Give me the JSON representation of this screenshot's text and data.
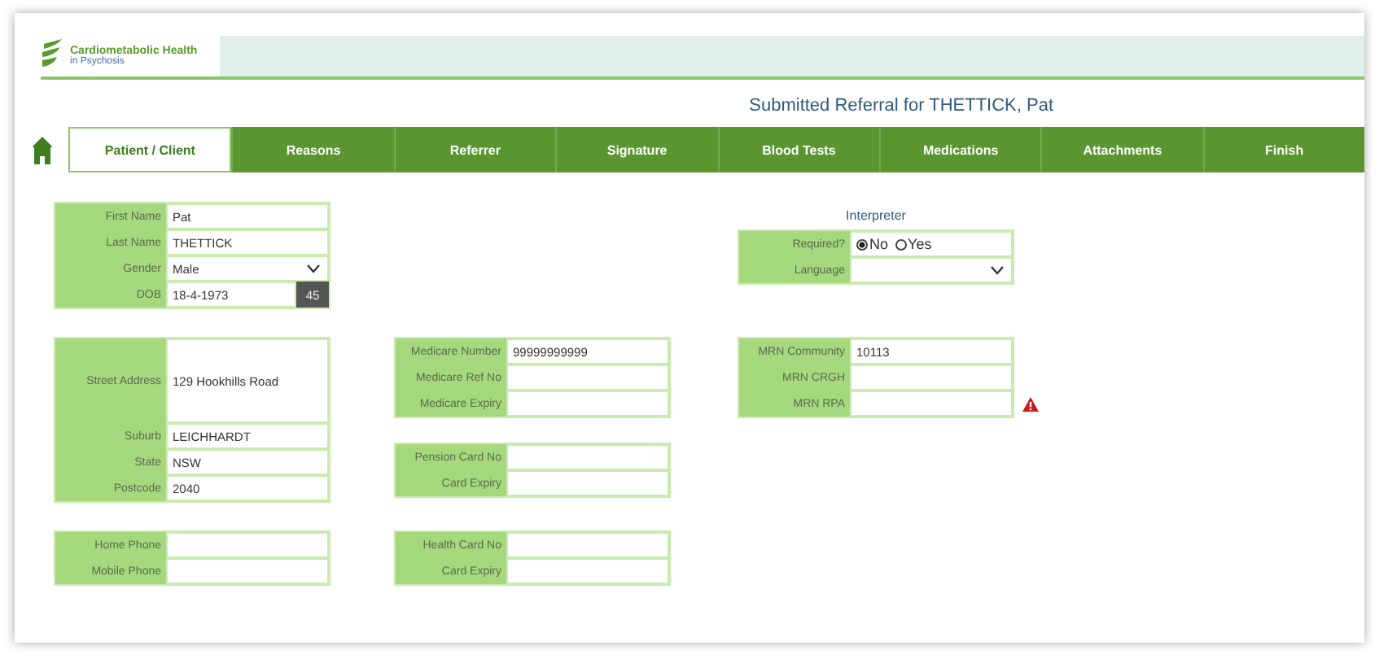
{
  "logo": {
    "lines": [
      "Cardiometabolic Health",
      "in Psychosis"
    ]
  },
  "title": "Submitted Referral for THETTICK, Pat",
  "tabs": [
    {
      "label": "Patient / Client",
      "selected": true
    },
    {
      "label": "Reasons",
      "selected": false
    },
    {
      "label": "Referrer",
      "selected": false
    },
    {
      "label": "Signature",
      "selected": false
    },
    {
      "label": "Blood Tests",
      "selected": false
    },
    {
      "label": "Medications",
      "selected": false
    },
    {
      "label": "Attachments",
      "selected": false
    },
    {
      "label": "Finish",
      "selected": false
    }
  ],
  "bands": [
    {
      "left": [
        {
          "fields": [
            {
              "kind": "text",
              "label": "First Name",
              "value": "Pat"
            },
            {
              "kind": "text",
              "label": "Last Name",
              "value": "THETTICK"
            },
            {
              "kind": "select",
              "label": "Gender",
              "value": "Male"
            },
            {
              "kind": "dob",
              "label": "DOB",
              "value": "18-4-1973",
              "age": "45"
            }
          ]
        }
      ],
      "right": [
        {
          "heading": "Interpreter",
          "fields": [
            {
              "kind": "radio",
              "label": "Required?",
              "options": [
                {
                  "label": "No",
                  "selected": true
                },
                {
                  "label": "Yes",
                  "selected": false
                }
              ]
            },
            {
              "kind": "select",
              "label": "Language"
            }
          ]
        }
      ]
    },
    {
      "left": [
        {
          "fields": [
            {
              "kind": "multiline",
              "label": "Street Address",
              "value": "129 Hookhills Road"
            },
            {
              "kind": "text",
              "label": "Suburb",
              "value": "LEICHHARDT"
            },
            {
              "kind": "text",
              "label": "State",
              "value": "NSW"
            },
            {
              "kind": "text",
              "label": "Postcode",
              "value": "2040"
            }
          ]
        }
      ],
      "middle": [
        {
          "fields": [
            {
              "kind": "text",
              "label": "Medicare Number",
              "value": "99999999999"
            },
            {
              "kind": "text",
              "label": "Medicare Ref No"
            },
            {
              "kind": "text",
              "label": "Medicare Expiry"
            }
          ]
        },
        {
          "fields": [
            {
              "kind": "text",
              "label": "Pension Card No"
            },
            {
              "kind": "text",
              "label": "Card Expiry"
            }
          ]
        }
      ],
      "right": [
        {
          "fields": [
            {
              "kind": "text",
              "label": "MRN Community",
              "value": "10113"
            },
            {
              "kind": "text",
              "label": "MRN CRGH"
            },
            {
              "kind": "text",
              "label": "MRN RPA",
              "warning": true
            }
          ]
        }
      ]
    },
    {
      "left": [
        {
          "fields": [
            {
              "kind": "text",
              "label": "Home Phone"
            },
            {
              "kind": "text",
              "label": "Mobile Phone"
            }
          ]
        }
      ],
      "middle": [
        {
          "fields": [
            {
              "kind": "text",
              "label": "Health Card No"
            },
            {
              "kind": "text",
              "label": "Card Expiry"
            }
          ]
        }
      ]
    }
  ]
}
